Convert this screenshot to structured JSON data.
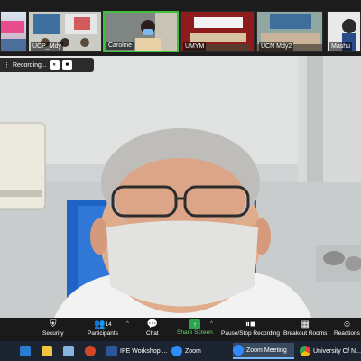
{
  "gallery": [
    {
      "name": ""
    },
    {
      "name": "UCP_Mdy"
    },
    {
      "name": "Caroline"
    },
    {
      "name": ""
    },
    {
      "name": "UMYM"
    },
    {
      "name": "UCN Mdy2"
    },
    {
      "name": "Mashu"
    }
  ],
  "recording": {
    "label": "Recording...",
    "pause_glyph": "⏸",
    "stop_glyph": "■"
  },
  "toolbar": {
    "security": "Security",
    "participants": "Participants",
    "participants_count": "14",
    "chat": "Chat",
    "share_screen": "Share Screen",
    "pause_stop": "Pause/Stop Recording",
    "breakout": "Breakout Rooms",
    "reactions": "Reactions"
  },
  "taskbar": {
    "ipe": "IPE Workshop ...",
    "zoom": "Zoom",
    "zoom_meeting": "Zoom Meeting",
    "chrome": "University Of N..."
  },
  "colors": {
    "share_green": "#2da44e",
    "speaker_border": "#3fc33f",
    "toolbar_bg": "#1a1a1a"
  }
}
